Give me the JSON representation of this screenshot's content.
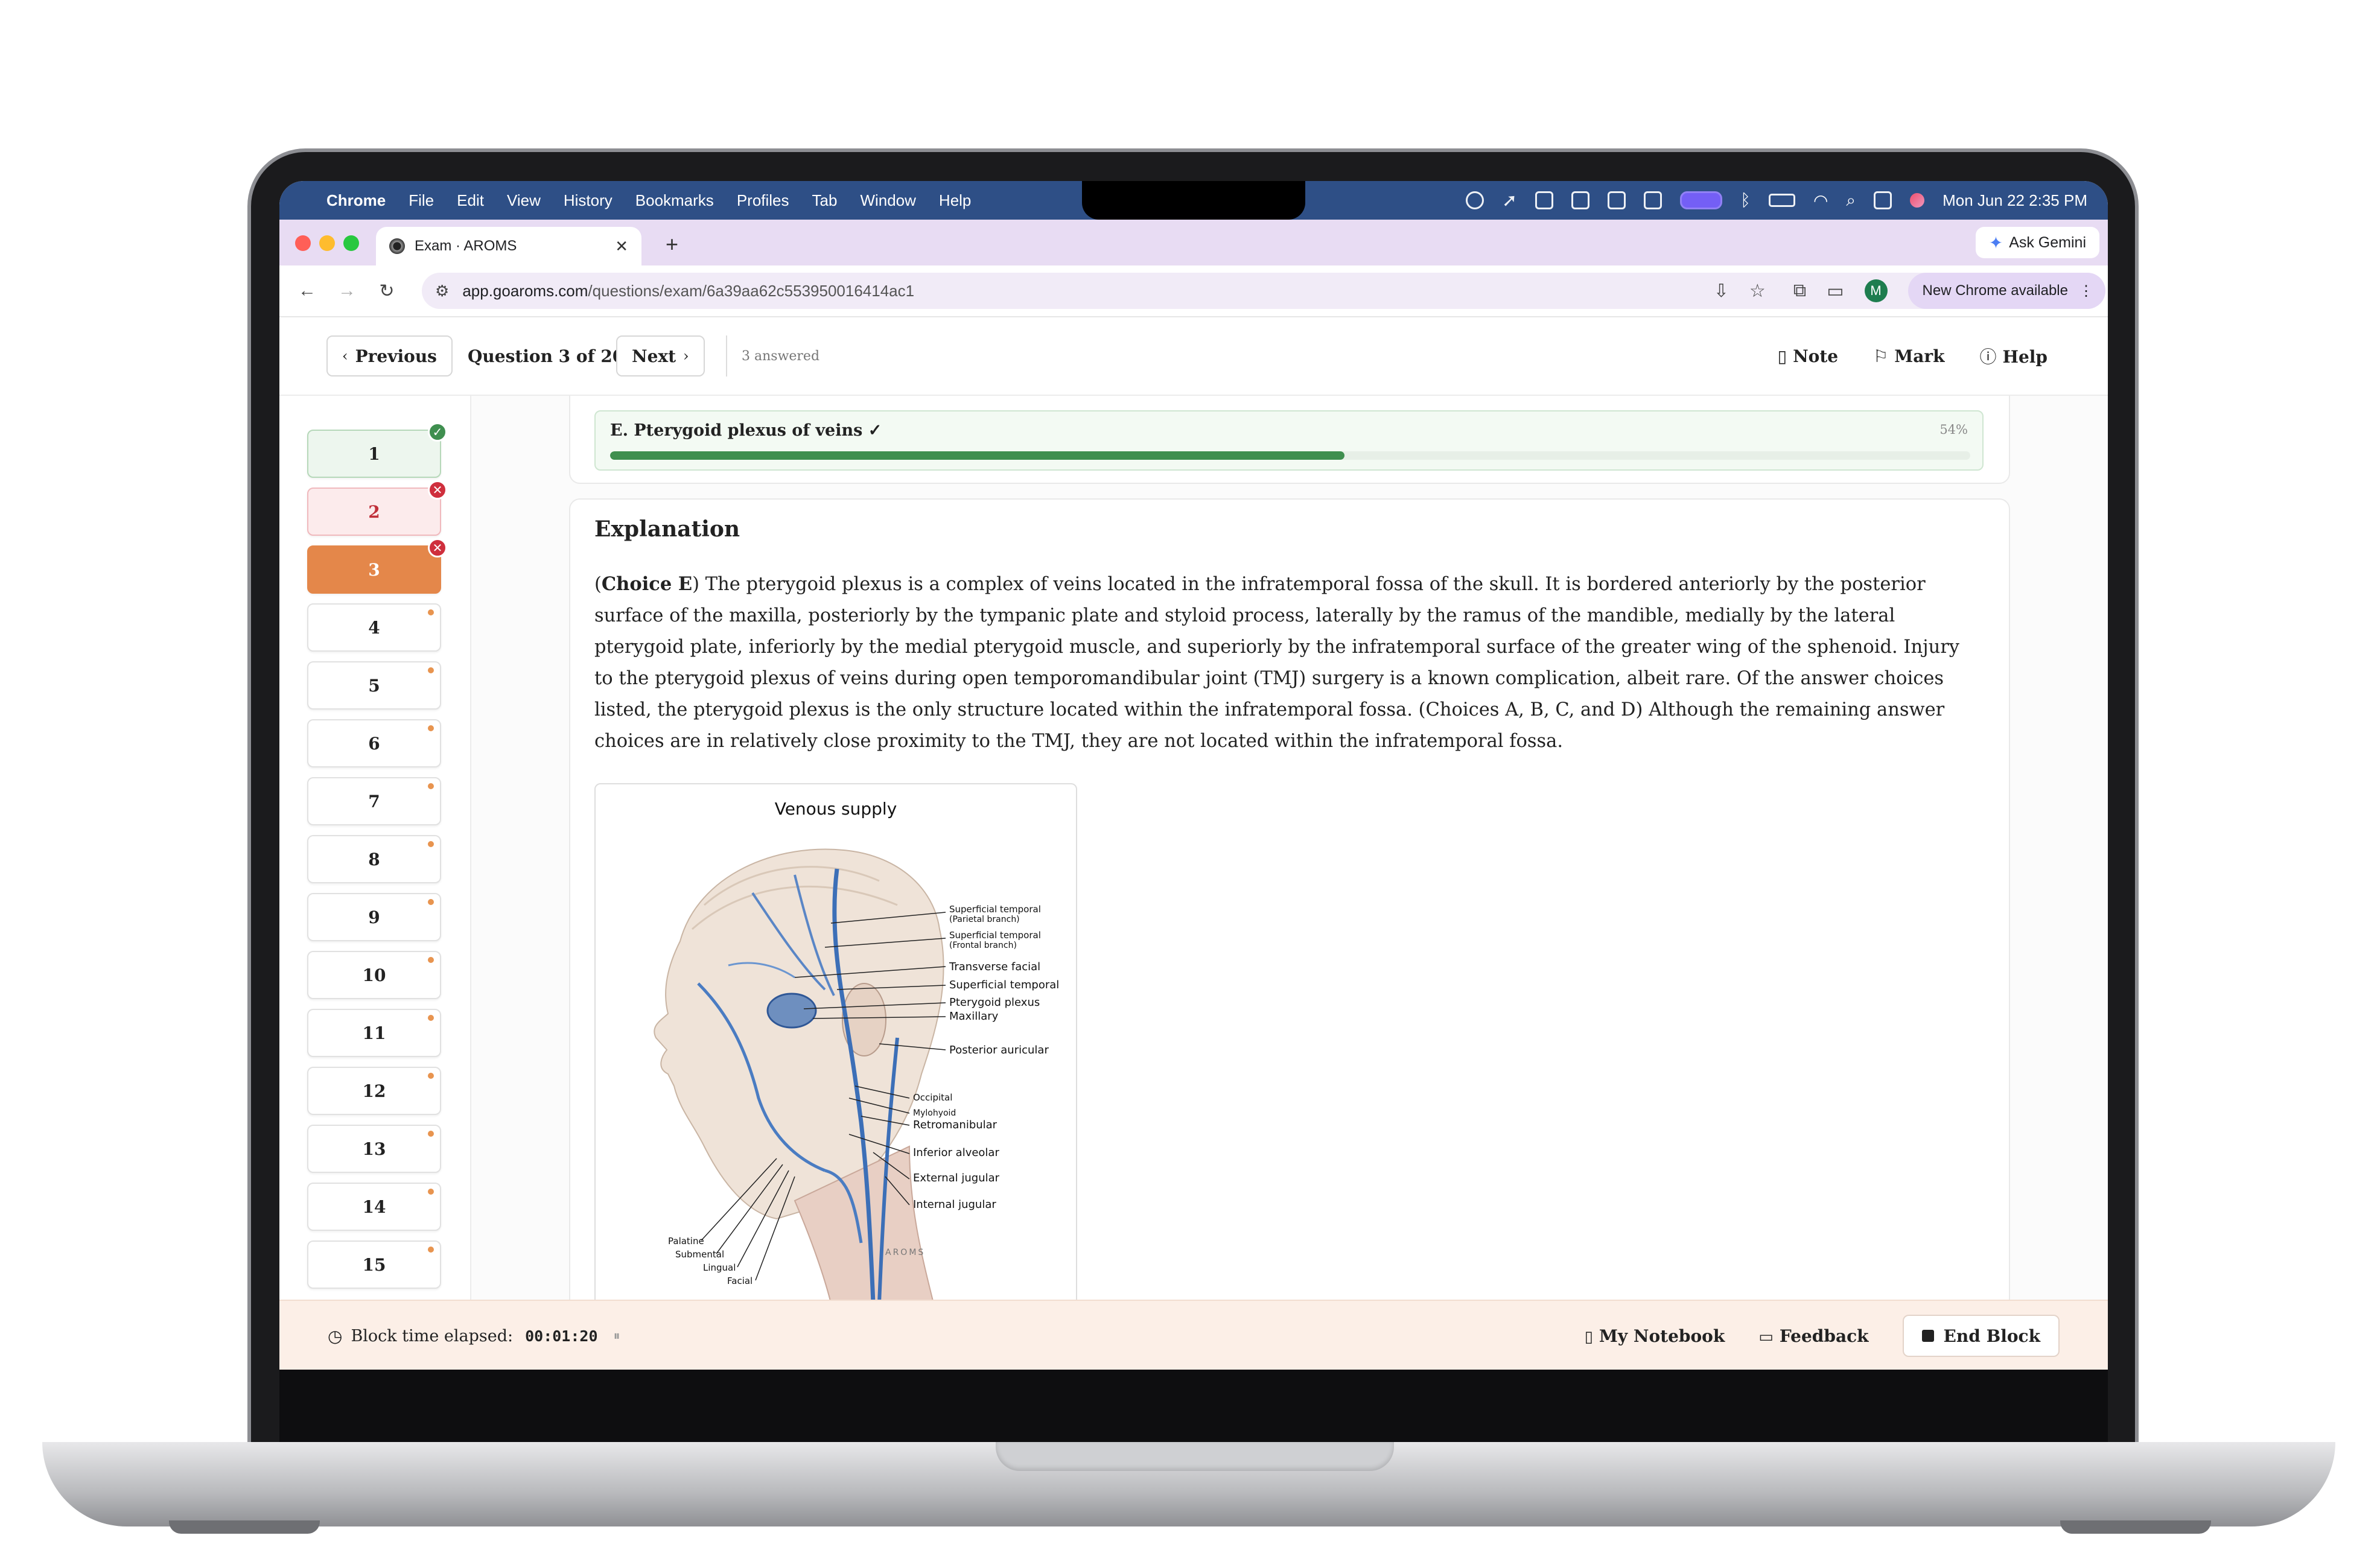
{
  "menubar": {
    "items": [
      "Chrome",
      "File",
      "Edit",
      "View",
      "History",
      "Bookmarks",
      "Profiles",
      "Tab",
      "Window",
      "Help"
    ],
    "datetime": "Mon Jun 22  2:35 PM"
  },
  "browser": {
    "tab_title": "Exam · AROMS",
    "ask_gemini": "Ask Gemini",
    "url_domain": "app.goaroms.com",
    "url_path": "/questions/exam/6a39aa62c553950016414ac1",
    "new_chrome": "New Chrome available",
    "profile_initial": "M"
  },
  "header": {
    "previous": "Previous",
    "question_of": "Question 3 of 20",
    "next": "Next",
    "answered": "3 answered",
    "note": "Note",
    "mark": "Mark",
    "help": "Help"
  },
  "sidebar": {
    "questions": [
      {
        "n": "1",
        "state": "correct"
      },
      {
        "n": "2",
        "state": "wrong"
      },
      {
        "n": "3",
        "state": "current-wrong"
      },
      {
        "n": "4",
        "state": "unanswered"
      },
      {
        "n": "5",
        "state": "unanswered"
      },
      {
        "n": "6",
        "state": "unanswered"
      },
      {
        "n": "7",
        "state": "unanswered"
      },
      {
        "n": "8",
        "state": "unanswered"
      },
      {
        "n": "9",
        "state": "unanswered"
      },
      {
        "n": "10",
        "state": "unanswered"
      },
      {
        "n": "11",
        "state": "unanswered"
      },
      {
        "n": "12",
        "state": "unanswered"
      },
      {
        "n": "13",
        "state": "unanswered"
      },
      {
        "n": "14",
        "state": "unanswered"
      },
      {
        "n": "15",
        "state": "unanswered"
      }
    ]
  },
  "choice_e": {
    "label": "E. Pterygoid plexus of veins ✓",
    "percent_label": "54%",
    "percent": 54
  },
  "explanation": {
    "heading": "Explanation",
    "choice_tag": "Choice E",
    "text": "The pterygoid plexus is a complex of veins located in the infratemporal fossa of the skull. It is bordered anteriorly by the posterior surface of the maxilla, posteriorly by the tympanic plate and styloid process, laterally by the ramus of the mandible, medially by the lateral pterygoid plate, inferiorly by the medial pterygoid muscle, and superiorly by the infratemporal surface of the greater wing of the sphenoid. Injury to the pterygoid plexus of veins during open temporomandibular joint (TMJ) surgery is a known complication, albeit rare. Of the answer choices listed, the pterygoid plexus is the only structure located within the infratemporal fossa. (Choices A, B, C, and D) Although the remaining answer choices are in relatively close proximity to the TMJ, they are not located within the infratemporal fossa."
  },
  "figure": {
    "title": "Venous supply",
    "labels": {
      "sup_temp_parietal_1": "Superficial temporal",
      "sup_temp_parietal_2": "(Parietal branch)",
      "sup_temp_frontal_1": "Superficial temporal",
      "sup_temp_frontal_2": "(Frontal branch)",
      "transverse_facial": "Transverse facial",
      "superficial_temporal": "Superficial temporal",
      "pterygoid_plexus": "Pterygoid plexus",
      "maxillary": "Maxillary",
      "posterior_auricular": "Posterior auricular",
      "occipital": "Occipital",
      "mylohyoid": "Mylohyoid",
      "retromandibular": "Retromanibular",
      "inferior_alveolar": "Inferior alveolar",
      "external_jugular": "External jugular",
      "internal_jugular": "Internal jugular",
      "palatine": "Palatine",
      "submental": "Submental",
      "lingual": "Lingual",
      "facial": "Facial",
      "brand": "AROMS"
    }
  },
  "footer": {
    "timer_label": "Block time elapsed:",
    "timer_value": "00:01:20",
    "pause_glyph": "⏸",
    "notebook": "My Notebook",
    "feedback": "Feedback",
    "end_block": "End Block"
  },
  "colors": {
    "correct": "#3f8f4f",
    "wrong": "#cf2f3d",
    "current": "#e4874a",
    "menubar": "#2e4f86",
    "tabstrip": "#e8dcf3"
  }
}
